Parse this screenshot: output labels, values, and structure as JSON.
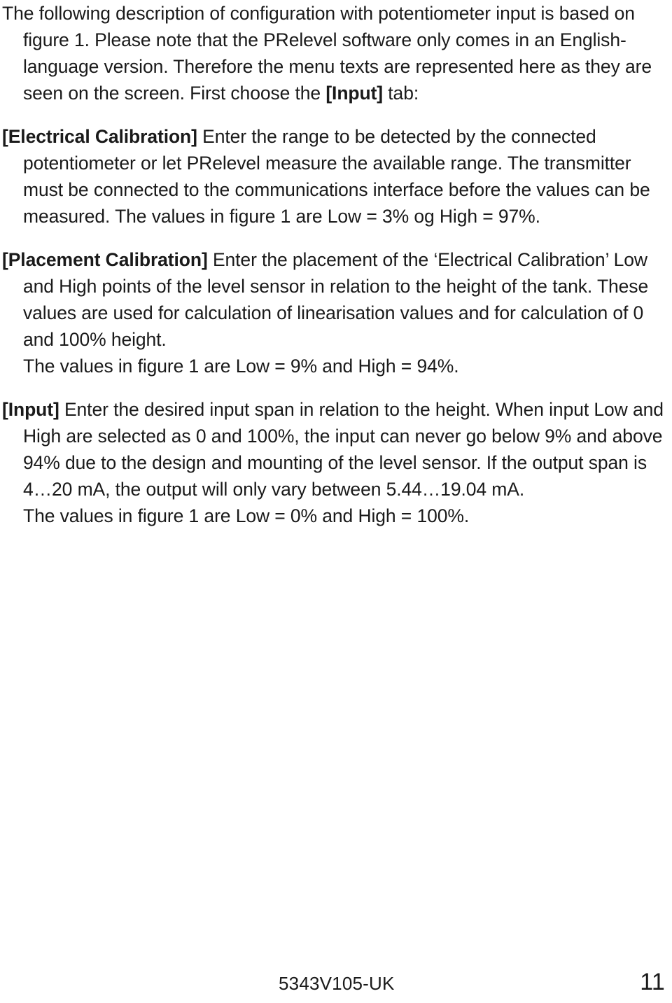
{
  "document": {
    "type": "manual-page",
    "background_color": "#ffffff",
    "text_color": "#1a1a1a",
    "paragraphs": [
      {
        "id": "intro",
        "lead": "",
        "body": "The following description of configuration with potentiometer input is based on figure 1. Please note that the PRelevel software only comes in an English-language version. Therefore the menu texts are represented here as they are seen on the screen. First choose the ",
        "body_bold_tail": "[Input]",
        "body_tail": " tab:"
      },
      {
        "id": "electrical-calibration",
        "lead": "[Electrical Calibration]",
        "body": " Enter the range to be detected by the connected potentiometer or let PRelevel measure the available range. The transmitter must be connected to the communications interface before the values can be measured. The values in figure 1 are Low = 3% og High = 97%.",
        "subline": ""
      },
      {
        "id": "placement-calibration",
        "lead": "[Placement Calibration]",
        "body": " Enter the placement of the ‘Electrical Calibration’ Low and High points of the level sensor in relation to the height of the tank. These values are used for calculation of linearisation values and for calculation of 0 and 100% height.",
        "subline": "The values in figure 1 are Low = 9% and High = 94%."
      },
      {
        "id": "input",
        "lead": "[Input]",
        "body": " Enter the desired input span in relation to the height. When input Low and High are selected as 0 and 100%, the input can never go below 9% and above 94% due to the design and mounting of the level sensor. If the output span is 4…20 mA, the output will only vary between 5.44…19.04 mA.",
        "subline": "The values in figure 1 are Low = 0% and High = 100%."
      }
    ]
  },
  "footer": {
    "document_code": "5343V105-UK",
    "page_number": "11"
  }
}
